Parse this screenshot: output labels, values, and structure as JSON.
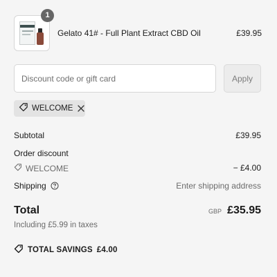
{
  "line_item": {
    "quantity": "1",
    "name": "Gelato 41# - Full Plant Extract CBD Oil",
    "price": "£39.95"
  },
  "discount": {
    "placeholder": "Discount code or gift card",
    "value": "",
    "apply_label": "Apply"
  },
  "applied_code": {
    "code": "WELCOME"
  },
  "summary": {
    "subtotal_label": "Subtotal",
    "subtotal_value": "£39.95",
    "order_discount_label": "Order discount",
    "discount_code": "WELCOME",
    "discount_value": "− £4.00",
    "shipping_label": "Shipping",
    "shipping_value": "Enter shipping address",
    "total_label": "Total",
    "total_currency": "GBP",
    "total_value": "£35.95",
    "taxes_note": "Including £5.99 in taxes",
    "savings_label": "TOTAL SAVINGS",
    "savings_value": "£4.00"
  },
  "icons": {
    "tag": "tag-icon",
    "remove": "close-icon",
    "help": "help-circle-icon",
    "savings": "savings-tag-icon"
  },
  "colors": {
    "background": "#f5f5f5",
    "badge": "#666666",
    "muted_text": "#6b6b6b",
    "chip_bg": "#e3e3e3"
  }
}
